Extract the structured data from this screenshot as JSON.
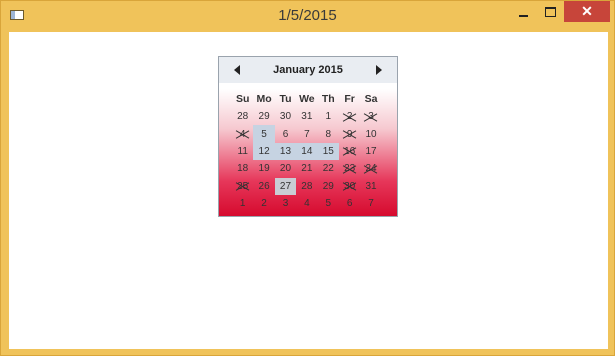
{
  "window": {
    "title": "1/5/2015",
    "close_glyph": "✕"
  },
  "calendar": {
    "month_label": "January 2015",
    "weekdays": [
      "Su",
      "Mo",
      "Tu",
      "We",
      "Th",
      "Fr",
      "Sa"
    ],
    "weeks": [
      [
        "28",
        "29",
        "30",
        "31",
        "1",
        "2",
        "3"
      ],
      [
        "4",
        "5",
        "6",
        "7",
        "8",
        "9",
        "10"
      ],
      [
        "11",
        "12",
        "13",
        "14",
        "15",
        "16",
        "17"
      ],
      [
        "18",
        "19",
        "20",
        "21",
        "22",
        "23",
        "24"
      ],
      [
        "25",
        "26",
        "27",
        "28",
        "29",
        "30",
        "31"
      ],
      [
        "1",
        "2",
        "3",
        "4",
        "5",
        "6",
        "7"
      ]
    ]
  },
  "icons": {
    "prev": "triangle-left-icon",
    "next": "triangle-right-icon",
    "app": "window-icon"
  },
  "colors": {
    "frame": "#f0c35a",
    "close": "#c7453a",
    "gradient_end": "#d60a2e",
    "highlight": "#c6d3e2"
  }
}
